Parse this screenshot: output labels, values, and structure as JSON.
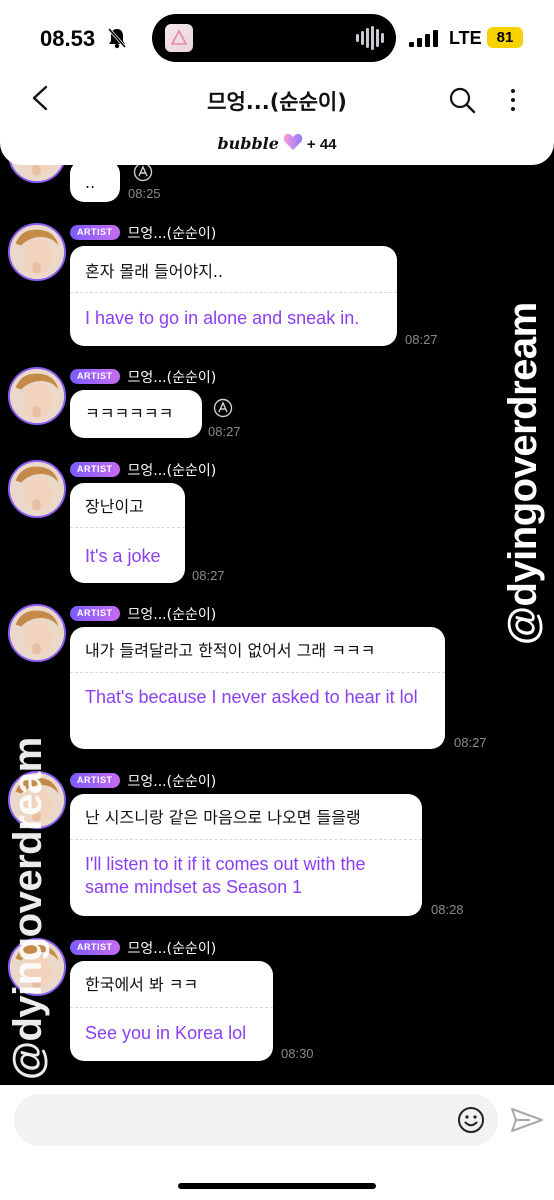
{
  "status_bar": {
    "time": "08.53",
    "network": "LTE",
    "battery": "81"
  },
  "header": {
    "title": "므엉...(순순이)",
    "bubble_word": "bubble",
    "plus_count": "+ 44"
  },
  "colors": {
    "accent_purple": "#8b3ff2",
    "badge_start": "#7c5cff",
    "badge_end": "#c56cf0",
    "battery_yellow": "#f5d200"
  },
  "icons": [
    "back-icon",
    "search-icon",
    "more-icon",
    "heart-icon",
    "translate-icon",
    "emoji-icon",
    "send-icon"
  ],
  "messages": [
    {
      "korean": "..",
      "time": "08:25"
    },
    {
      "badge": "ARTIST",
      "name": "므엉...(순순이)",
      "korean": "혼자 몰래 들어야지..",
      "english": "I have to go in alone and sneak in.",
      "time": "08:27"
    },
    {
      "badge": "ARTIST",
      "name": "므엉...(순순이)",
      "korean": "ㅋㅋㅋㅋㅋㅋ",
      "time": "08:27"
    },
    {
      "badge": "ARTIST",
      "name": "므엉...(순순이)",
      "korean": "장난이고",
      "english": "It's a joke",
      "time": "08:27"
    },
    {
      "badge": "ARTIST",
      "name": "므엉...(순순이)",
      "korean": "내가 들려달라고 한적이 없어서 그래 ㅋㅋㅋ",
      "english": "That's because I never asked to hear it lol",
      "time": "08:27"
    },
    {
      "badge": "ARTIST",
      "name": "므엉...(순순이)",
      "korean": "난 시즈니랑 같은 마음으로 나오면 들을랭",
      "english": "I'll listen to it if it comes out with the same mindset as Season 1",
      "time": "08:28"
    },
    {
      "badge": "ARTIST",
      "name": "므엉...(순순이)",
      "korean": "한국에서 봐 ㅋㅋ",
      "english": "See you in Korea lol",
      "time": "08:30"
    }
  ],
  "watermark": "@dyingoverdream"
}
